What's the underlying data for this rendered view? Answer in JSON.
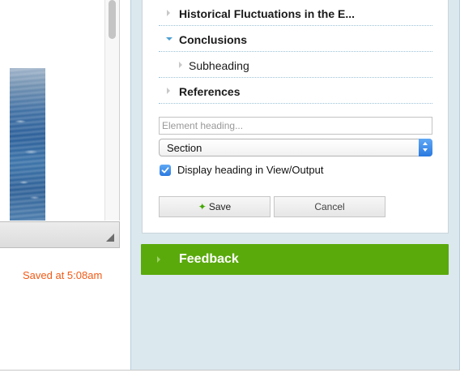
{
  "editor": {
    "saved_status": "Saved at 5:08am"
  },
  "outline": {
    "items": [
      {
        "label": "Historical Fluctuations in the E...",
        "expanded": false,
        "bold": true
      },
      {
        "label": "Conclusions",
        "expanded": true,
        "bold": true
      },
      {
        "label": "Subheading",
        "expanded": false,
        "bold": false
      },
      {
        "label": "References",
        "expanded": false,
        "bold": true
      }
    ]
  },
  "form": {
    "heading_placeholder": "Element heading...",
    "heading_value": "",
    "element_type": "Section",
    "display_heading_label": "Display heading in View/Output",
    "display_heading_checked": true,
    "save_label": "Save",
    "cancel_label": "Cancel"
  },
  "feedback": {
    "label": "Feedback"
  },
  "colors": {
    "accent_green": "#5aaa0c",
    "saved_orange": "#f25a15",
    "panel_bg": "#dbe8ee",
    "checkbox_blue": "#2a79e0"
  }
}
